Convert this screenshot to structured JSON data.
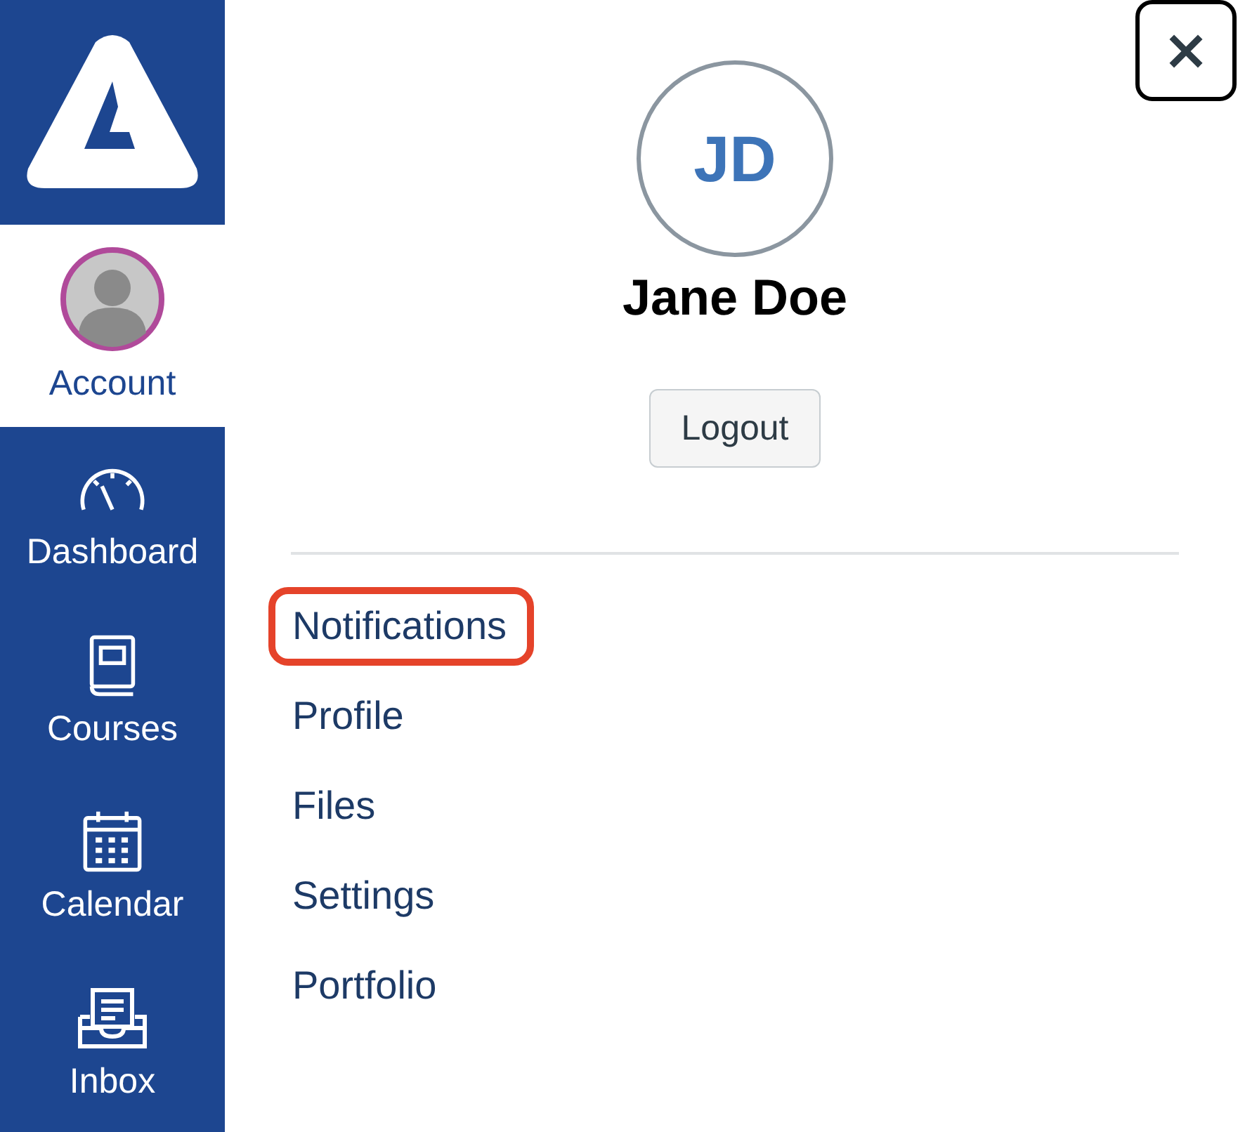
{
  "sidebar": {
    "items": [
      {
        "kind": "account",
        "label": "Account",
        "selected": true
      },
      {
        "kind": "dashboard",
        "label": "Dashboard",
        "selected": false
      },
      {
        "kind": "courses",
        "label": "Courses",
        "selected": false
      },
      {
        "kind": "calendar",
        "label": "Calendar",
        "selected": false
      },
      {
        "kind": "inbox",
        "label": "Inbox",
        "selected": false
      }
    ]
  },
  "close_button": {
    "label": "×"
  },
  "profile": {
    "initials": "JD",
    "name": "Jane Doe",
    "logout": "Logout"
  },
  "links": [
    {
      "label": "Notifications",
      "highlighted": true
    },
    {
      "label": "Profile",
      "highlighted": false
    },
    {
      "label": "Files",
      "highlighted": false
    },
    {
      "label": "Settings",
      "highlighted": false
    },
    {
      "label": "Portfolio",
      "highlighted": false
    }
  ]
}
